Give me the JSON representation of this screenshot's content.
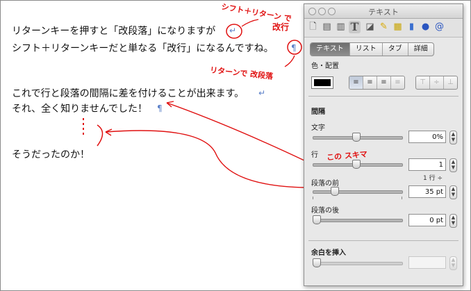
{
  "document": {
    "lines": [
      "リターンキーを押すと「改段落」になりますが",
      "シフト＋リターンキーだと単なる「改行」になるんですね。",
      "これで行と段落の間隔に差を付けることが出来ます。",
      "それ、全く知りませんでした！",
      "そうだったのか！"
    ],
    "return_mark": "↵",
    "pilcrow": "¶",
    "annotations": {
      "shift_return": "シフト＋リターン で",
      "kaigyou": "改行",
      "return_paragraph": "リターンで 改段落",
      "this_space": "この スキマ"
    },
    "annotation_color": "#e01010"
  },
  "panel": {
    "title": "テキスト",
    "toolbar_icons": [
      "document-icon",
      "layout-icon",
      "wrap-icon",
      "text-icon",
      "graphic-icon",
      "metrics-icon",
      "table-icon",
      "chart-icon",
      "link-icon",
      "quicktime-icon"
    ],
    "tabs": [
      {
        "label": "テキスト",
        "selected": true
      },
      {
        "label": "リスト",
        "selected": false
      },
      {
        "label": "タブ",
        "selected": false
      },
      {
        "label": "詳細",
        "selected": false
      }
    ],
    "color_section_label": "色・配置",
    "spacing_section_label": "間隔",
    "char_label": "文字",
    "char_value": "0%",
    "line_label": "行",
    "line_value": "1",
    "line_unit": "1 行 ÷",
    "before_label": "段落の前",
    "before_value": "35 pt",
    "after_label": "段落の後",
    "after_value": "0 pt",
    "inset_label": "余白を挿入",
    "inset_value": "",
    "sliders": {
      "char": 0.48,
      "line": 0.48,
      "before": 0.22,
      "after": 0.0,
      "inset": 0.0
    }
  }
}
